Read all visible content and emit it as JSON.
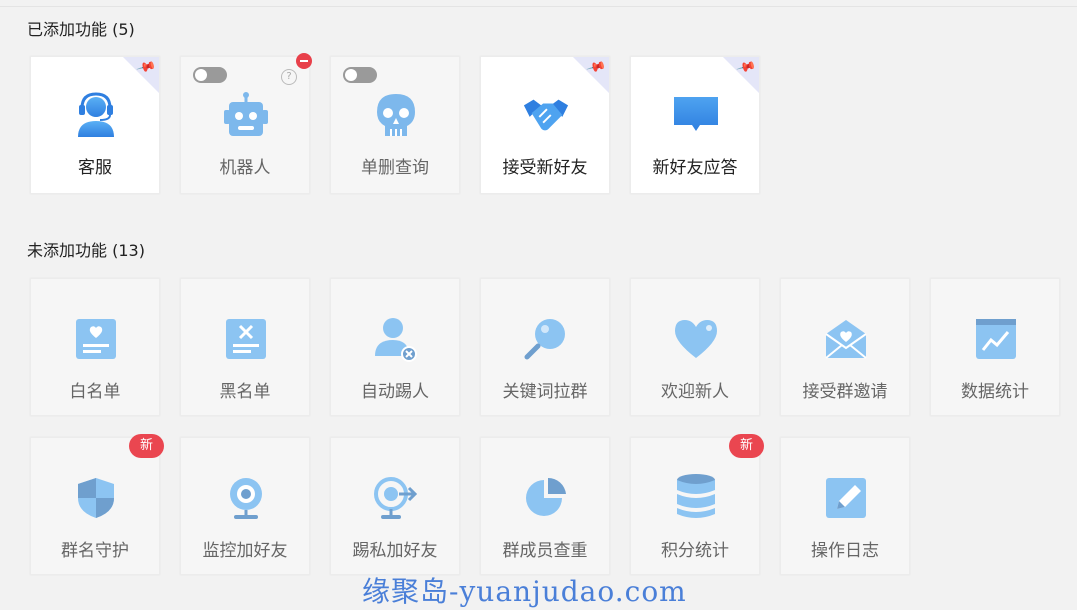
{
  "added": {
    "title": "已添加功能 (5)",
    "items": [
      {
        "label": "客服",
        "icon": "customer-service-icon",
        "active": true
      },
      {
        "label": "机器人",
        "icon": "robot-icon",
        "active": false
      },
      {
        "label": "单删查询",
        "icon": "skull-icon",
        "active": false
      },
      {
        "label": "接受新好友",
        "icon": "handshake-icon",
        "active": true
      },
      {
        "label": "新好友应答",
        "icon": "chat-bubble-icon",
        "active": true
      }
    ]
  },
  "not_added": {
    "title": "未添加功能 (13)",
    "items": [
      {
        "label": "白名单",
        "icon": "whitelist-icon"
      },
      {
        "label": "黑名单",
        "icon": "blacklist-icon"
      },
      {
        "label": "自动踢人",
        "icon": "kick-user-icon"
      },
      {
        "label": "关键词拉群",
        "icon": "keyword-search-icon"
      },
      {
        "label": "欢迎新人",
        "icon": "heart-icon"
      },
      {
        "label": "接受群邀请",
        "icon": "invite-envelope-icon"
      },
      {
        "label": "数据统计",
        "icon": "chart-icon"
      },
      {
        "label": "群名守护",
        "icon": "shield-icon",
        "badge": "新"
      },
      {
        "label": "监控加好友",
        "icon": "webcam-icon"
      },
      {
        "label": "踢私加好友",
        "icon": "webcam-arrow-icon"
      },
      {
        "label": "群成员查重",
        "icon": "pie-chart-icon"
      },
      {
        "label": "积分统计",
        "icon": "database-icon",
        "badge": "新"
      },
      {
        "label": "操作日志",
        "icon": "edit-log-icon"
      }
    ]
  },
  "help_glyph": "?",
  "watermark": "缘聚岛-yuanjudao.com",
  "colors": {
    "icon_blue": "#3a8ee6",
    "icon_light": "#8cc4f2",
    "badge_red": "#ea4650"
  }
}
